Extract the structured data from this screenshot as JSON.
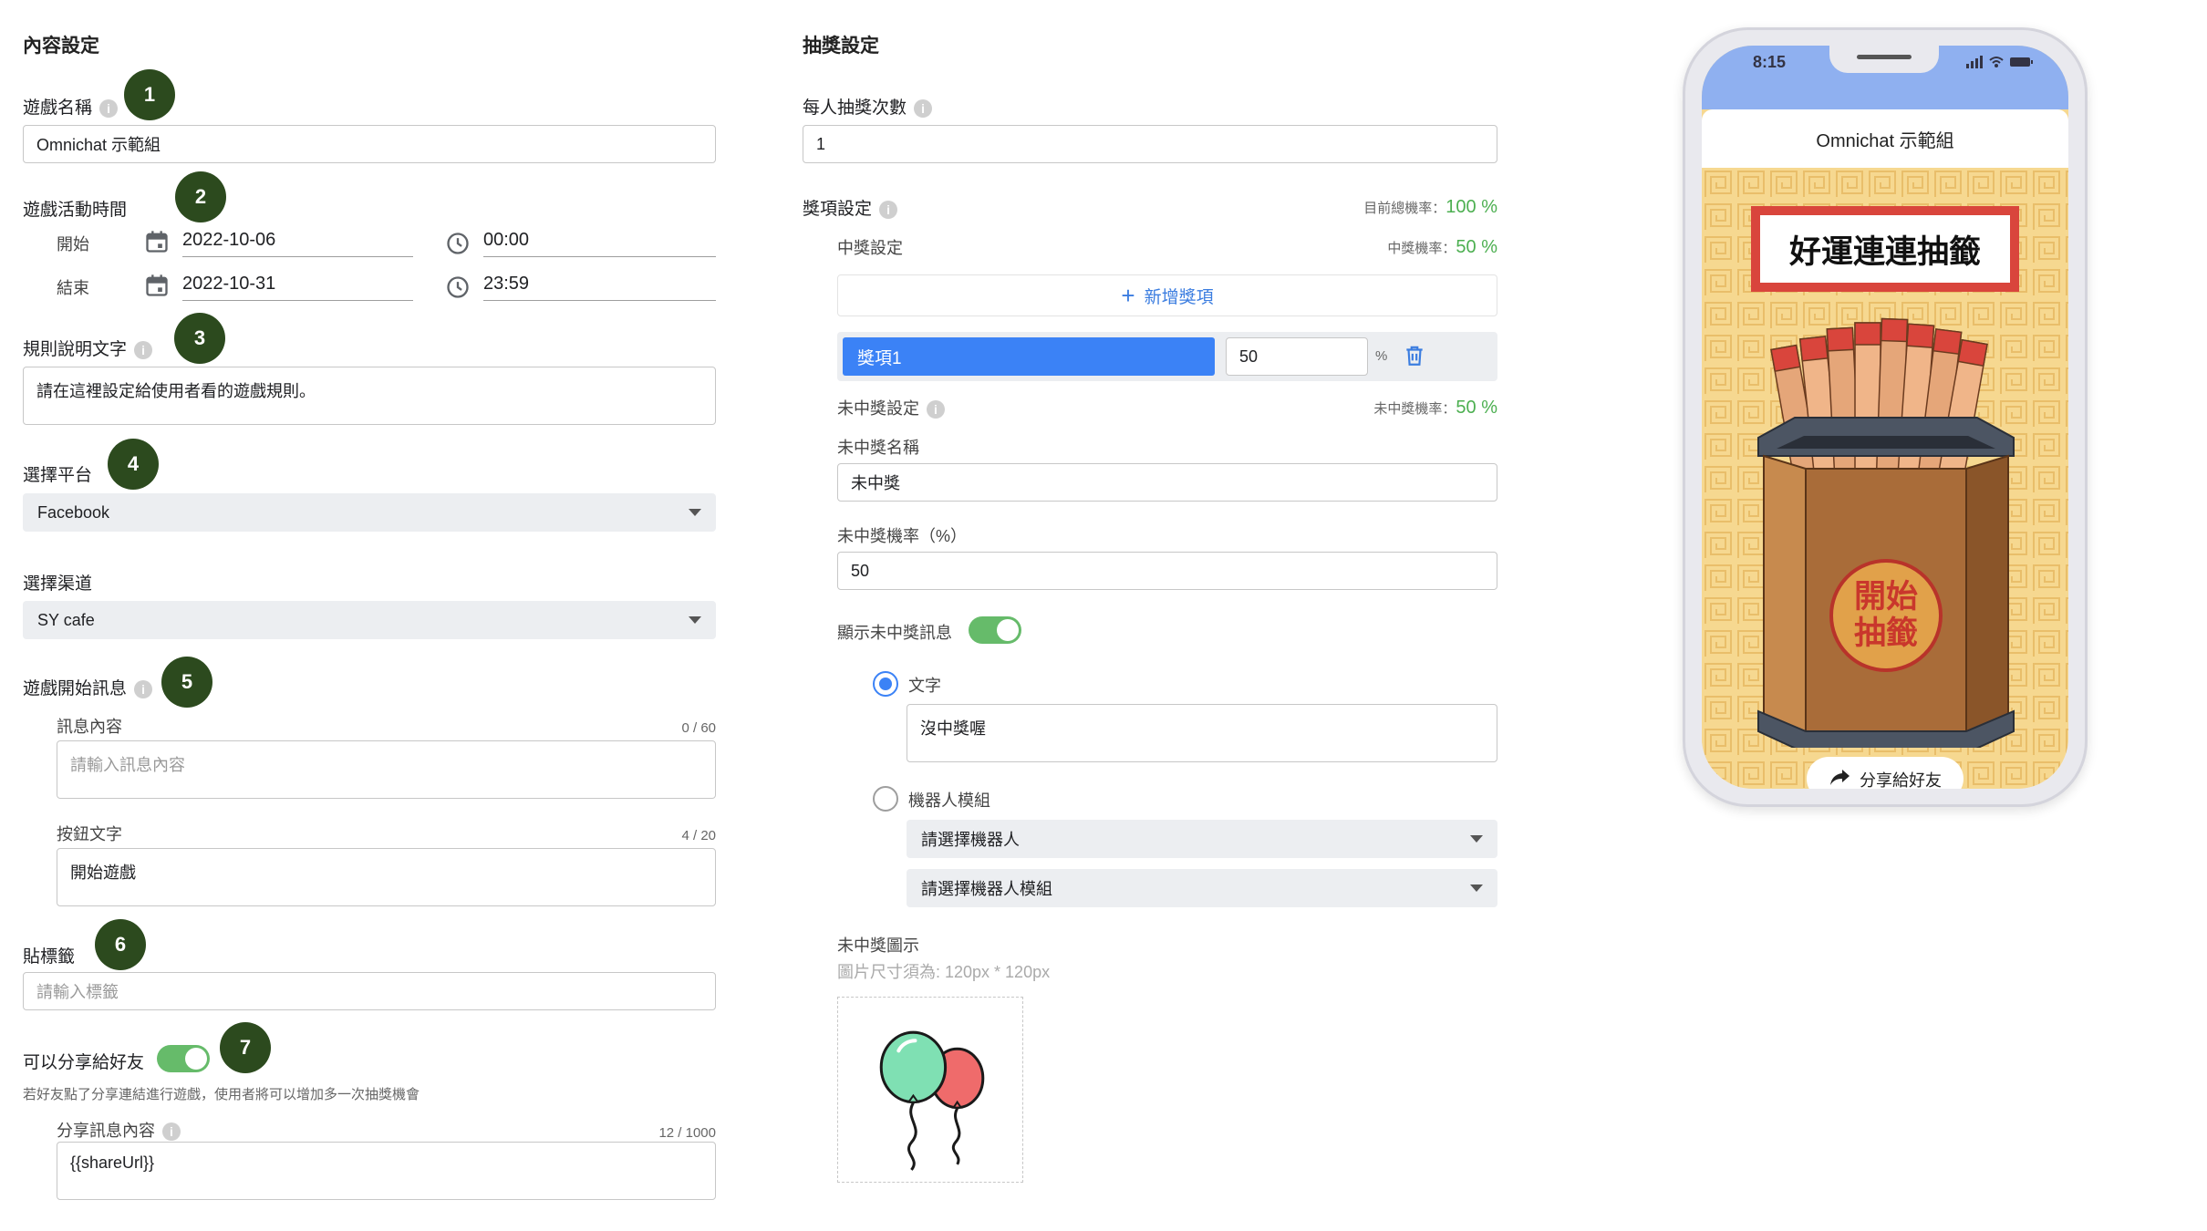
{
  "content": {
    "title": "內容設定",
    "game_name": {
      "label": "遊戲名稱",
      "value": "Omnichat 示範組"
    },
    "period": {
      "label": "遊戲活動時間",
      "start_label": "開始",
      "start_date": "2022-10-06",
      "start_time": "00:00",
      "end_label": "結束",
      "end_date": "2022-10-31",
      "end_time": "23:59"
    },
    "rules": {
      "label": "規則說明文字",
      "value": "請在這裡設定給使用者看的遊戲規則。"
    },
    "platform": {
      "label": "選擇平台",
      "value": "Facebook"
    },
    "channel": {
      "label": "選擇渠道",
      "value": "SY cafe"
    },
    "start_message": {
      "label": "遊戲開始訊息",
      "message_label": "訊息內容",
      "message_counter": "0 / 60",
      "message_placeholder": "請輸入訊息內容",
      "button_label": "按鈕文字",
      "button_counter": "4 / 20",
      "button_value": "開始遊戲"
    },
    "tags": {
      "label": "貼標籤",
      "placeholder": "請輸入標籤"
    },
    "share": {
      "label": "可以分享給好友",
      "hint": "若好友點了分享連結進行遊戲，使用者將可以增加多一次抽獎機會",
      "content_label": "分享訊息內容",
      "content_counter": "12 / 1000",
      "content_value": "{{shareUrl}}",
      "enabled": true
    },
    "badges": [
      "1",
      "2",
      "3",
      "4",
      "5",
      "6",
      "7"
    ]
  },
  "lottery": {
    "title": "抽獎設定",
    "draws": {
      "label": "每人抽獎次數",
      "value": "1"
    },
    "prize_settings": {
      "label": "獎項設定",
      "total_label": "目前總機率：",
      "total_value": "100 %",
      "win_label": "中獎設定",
      "win_rate_label": "中獎機率：",
      "win_rate_value": "50 %",
      "add_button": "新增獎項",
      "prize_name": "獎項1",
      "prize_rate": "50",
      "percent_sign": "%"
    },
    "no_prize": {
      "label": "未中獎設定",
      "rate_label": "未中獎機率：",
      "rate_value": "50 %",
      "name_label": "未中獎名稱",
      "name_value": "未中獎",
      "rate_field_label": "未中獎機率（%）",
      "rate_field_value": "50",
      "show_message_label": "顯示未中獎訊息",
      "show_message_enabled": true,
      "option_text": "文字",
      "text_value": "沒中獎喔",
      "option_bot": "機器人模組",
      "bot_select_placeholder": "請選擇機器人",
      "bot_module_placeholder": "請選擇機器人模組",
      "image_label": "未中獎圖示",
      "image_hint": "圖片尺寸須為: 120px * 120px"
    }
  },
  "preview": {
    "time": "8:15",
    "title": "Omnichat 示範組",
    "banner": "好運連連抽籤",
    "start_line1": "開始",
    "start_line2": "抽籤",
    "share_button": "分享給好友"
  }
}
